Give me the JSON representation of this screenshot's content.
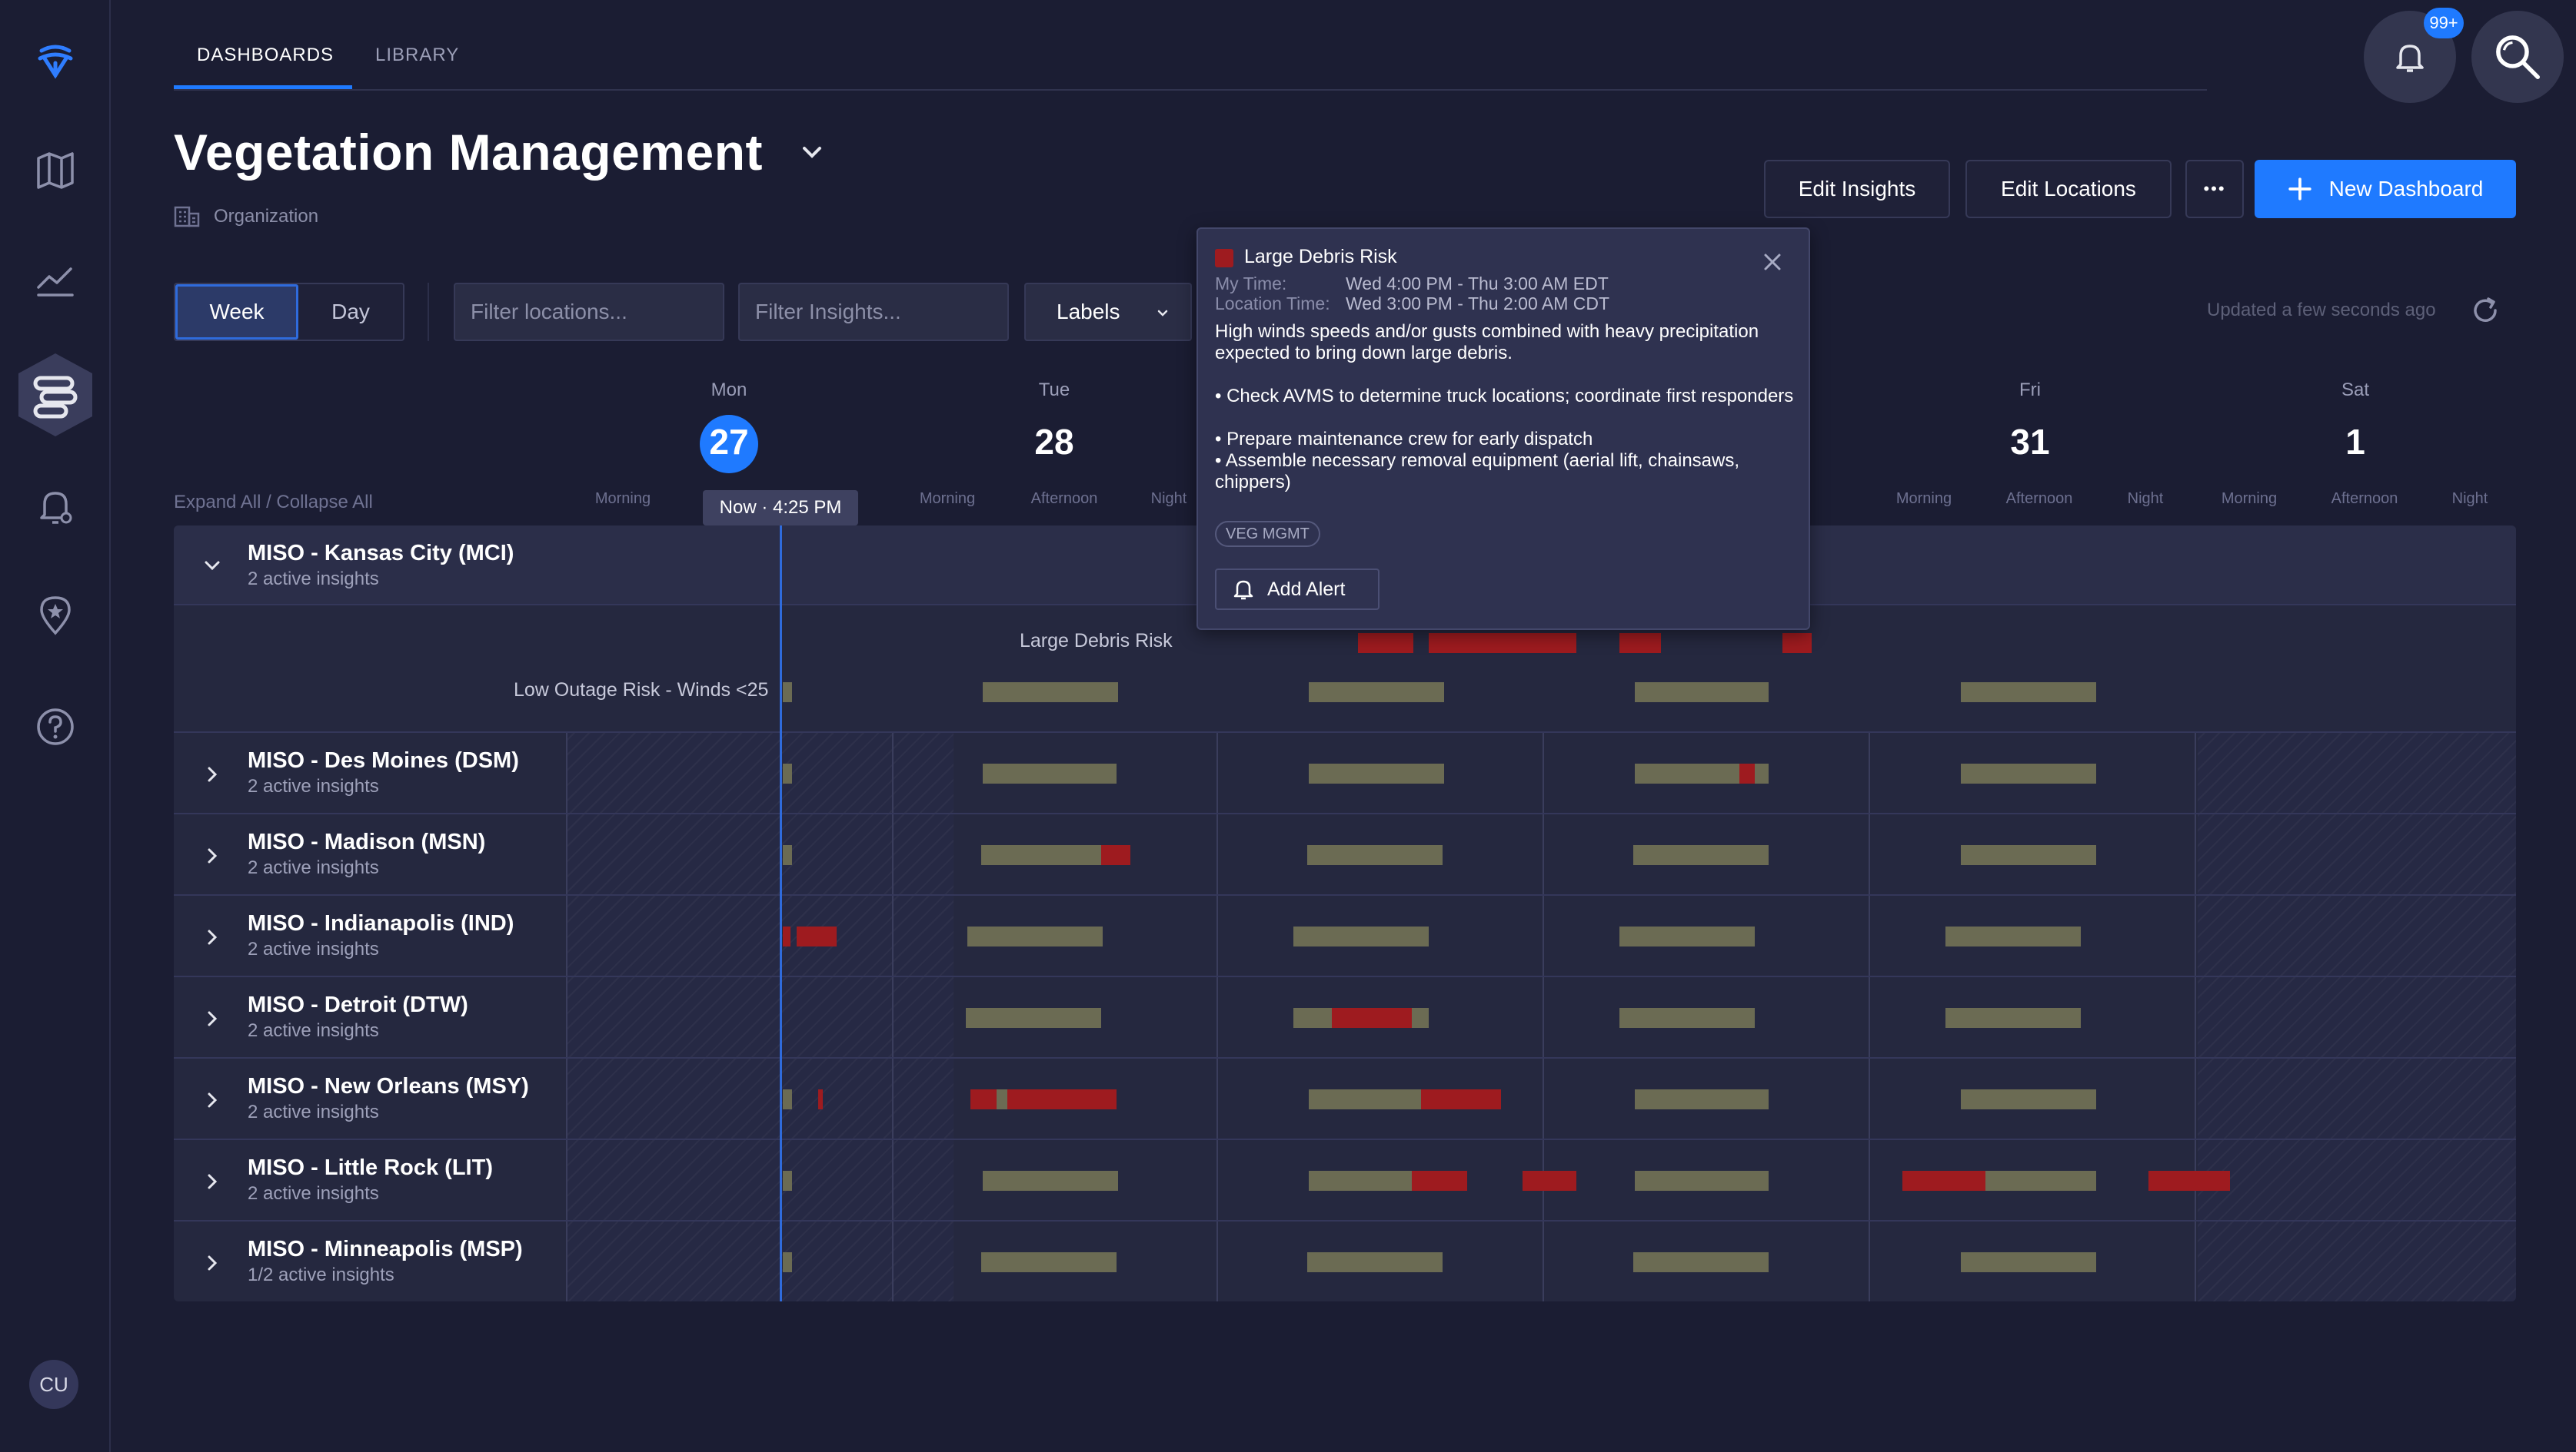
{
  "tabs": {
    "dashboards": "DASHBOARDS",
    "library": "LIBRARY"
  },
  "notifications": {
    "badge": "99+"
  },
  "title": "Vegetation Management",
  "org_label": "Organization",
  "actions": {
    "edit_insights": "Edit Insights",
    "edit_locations": "Edit Locations",
    "more": "•••",
    "new_dashboard": "New Dashboard"
  },
  "filters": {
    "week": "Week",
    "day": "Day",
    "locations_placeholder": "Filter locations...",
    "insights_placeholder": "Filter Insights...",
    "labels": "Labels"
  },
  "updated": "Updated a few seconds ago",
  "expand_collapse": "Expand All  /  Collapse All",
  "now_tag": "Now · 4:25 PM",
  "days": [
    {
      "name": "Mon",
      "num": "27"
    },
    {
      "name": "Tue",
      "num": "28"
    },
    {
      "name": "Fri",
      "num": "31"
    },
    {
      "name": "Sat",
      "num": "1"
    }
  ],
  "periods": [
    "Morning",
    "Afternoon",
    "Night"
  ],
  "rows": [
    {
      "title": "MISO - Kansas City (MCI)",
      "sub": "2 active insights"
    },
    {
      "title": "MISO - Des Moines (DSM)",
      "sub": "2 active insights"
    },
    {
      "title": "MISO - Madison (MSN)",
      "sub": "2 active insights"
    },
    {
      "title": "MISO - Indianapolis (IND)",
      "sub": "2 active insights"
    },
    {
      "title": "MISO - Detroit (DTW)",
      "sub": "2 active insights"
    },
    {
      "title": "MISO - New Orleans (MSY)",
      "sub": "2 active insights"
    },
    {
      "title": "MISO - Little Rock (LIT)",
      "sub": "2 active insights"
    },
    {
      "title": "MISO - Minneapolis (MSP)",
      "sub": "1/2 active insights"
    }
  ],
  "expanded_insights": {
    "large_debris": "Large Debris Risk",
    "low_outage": "Low Outage Risk - Winds <25"
  },
  "popover": {
    "title": "Large Debris Risk",
    "my_time_label": "My Time:",
    "my_time": "Wed 4:00 PM - Thu 3:00 AM EDT",
    "location_time_label": "Location Time:",
    "location_time": "Wed 3:00 PM - Thu 2:00 AM CDT",
    "description": "High winds speeds and/or gusts combined with heavy precipitation expected to bring down large debris.",
    "bullets": [
      "• Check AVMS to determine truck locations; coordinate first responders",
      "• Prepare maintenance crew for early dispatch",
      "• Assemble necessary removal equipment (aerial lift, chainsaws, chippers)"
    ],
    "tag": "VEG MGMT",
    "add_alert": "Add Alert"
  },
  "avatar": "CU",
  "colors": {
    "accent": "#1f7aff",
    "risk_red": "#9e1b1f",
    "olive": "#6b6b53",
    "background": "#1b1d33"
  }
}
